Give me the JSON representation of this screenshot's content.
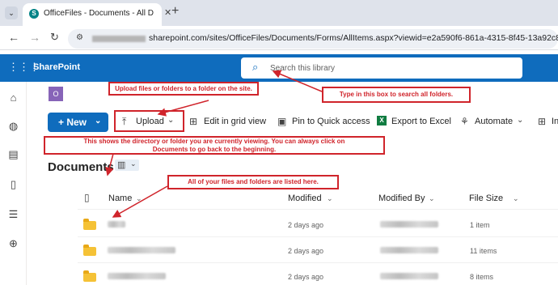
{
  "browser": {
    "tab_title": "OfficeFiles - Documents - All D",
    "new_tab_glyph": "+",
    "url_prefix": "sharepoint.com/sites/OfficeFiles/Documents/Forms/AllItems.aspx?viewid=e2a590f6-861a-4315-8f45-13a92c8d"
  },
  "suite": {
    "app_name": "SharePoint",
    "search_placeholder": "Search this library"
  },
  "site": {
    "logo_letter": "O",
    "logo_color": "#8764b8"
  },
  "toolbar": {
    "new_label": "+ New",
    "upload_label": "Upload",
    "grid_label": "Edit in grid view",
    "pin_label": "Pin to Quick access",
    "export_label": "Export to Excel",
    "automate_label": "Automate",
    "more_label": "In"
  },
  "library": {
    "title": "Documents"
  },
  "table": {
    "headers": {
      "name": "Name",
      "modified": "Modified",
      "modified_by": "Modified By",
      "file_size": "File Size"
    },
    "rows": [
      {
        "modified": "2 days ago",
        "size": "1 item"
      },
      {
        "modified": "2 days ago",
        "size": "11 items"
      },
      {
        "modified": "2 days ago",
        "size": "8 items"
      }
    ]
  },
  "callouts": {
    "upload": "Upload files or folders to a folder on the site.",
    "search": "Type in this box to search all folders.",
    "directory": "This shows the directory or folder you are currently viewing.  You can always click on Documents to go back to the beginning.",
    "files": "All of your files and folders are listed here."
  },
  "colors": {
    "brand": "#0f6cbd",
    "callout": "#d0242b",
    "excel": "#107c41"
  }
}
